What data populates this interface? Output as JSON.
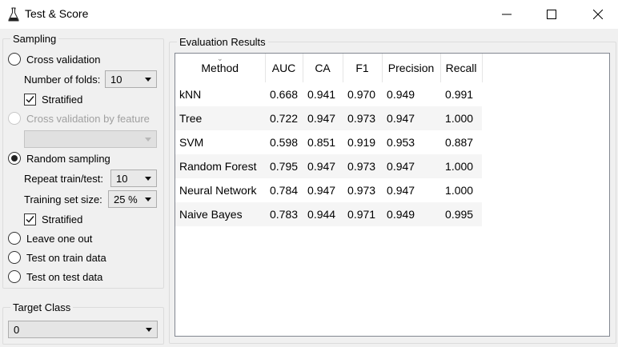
{
  "window": {
    "title": "Test & Score"
  },
  "sampling": {
    "title": "Sampling",
    "cross_validation": {
      "label": "Cross validation",
      "checked": false
    },
    "folds": {
      "label": "Number of folds:",
      "value": "10"
    },
    "stratified1": {
      "label": "Stratified",
      "checked": true
    },
    "cv_by_feature": {
      "label": "Cross validation by feature",
      "enabled": false
    },
    "feature_select": {
      "value": ""
    },
    "random_sampling": {
      "label": "Random sampling",
      "checked": true
    },
    "repeat": {
      "label": "Repeat train/test:",
      "value": "10"
    },
    "train_size": {
      "label": "Training set size:",
      "value": "25 %"
    },
    "stratified2": {
      "label": "Stratified",
      "checked": true
    },
    "leave_one_out": {
      "label": "Leave one out",
      "checked": false
    },
    "test_train": {
      "label": "Test on train data",
      "checked": false
    },
    "test_test": {
      "label": "Test on test data",
      "checked": false
    }
  },
  "target_class": {
    "title": "Target Class",
    "value": "0"
  },
  "evaluation": {
    "title": "Evaluation Results",
    "columns": [
      "Method",
      "AUC",
      "CA",
      "F1",
      "Precision",
      "Recall"
    ],
    "rows": [
      [
        "kNN",
        "0.668",
        "0.941",
        "0.970",
        "0.949",
        "0.991"
      ],
      [
        "Tree",
        "0.722",
        "0.947",
        "0.973",
        "0.947",
        "1.000"
      ],
      [
        "SVM",
        "0.598",
        "0.851",
        "0.919",
        "0.953",
        "0.887"
      ],
      [
        "Random Forest",
        "0.795",
        "0.947",
        "0.973",
        "0.947",
        "1.000"
      ],
      [
        "Neural Network",
        "0.784",
        "0.947",
        "0.973",
        "0.947",
        "1.000"
      ],
      [
        "Naive Bayes",
        "0.783",
        "0.944",
        "0.971",
        "0.949",
        "0.995"
      ]
    ]
  },
  "icons": {
    "app": "flask-icon",
    "minimize": "minimize-icon",
    "maximize": "maximize-icon",
    "close": "close-icon"
  }
}
